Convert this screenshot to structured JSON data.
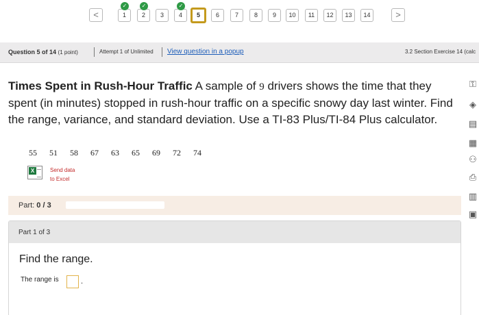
{
  "nav": {
    "prev_label": "<",
    "next_label": ">",
    "questions": [
      {
        "label": "1",
        "completed": true
      },
      {
        "label": "2",
        "completed": true
      },
      {
        "label": "3",
        "completed": false
      },
      {
        "label": "4",
        "completed": true
      },
      {
        "label": "5",
        "completed": false,
        "current": true
      },
      {
        "label": "6",
        "completed": false
      },
      {
        "label": "7",
        "completed": false
      },
      {
        "label": "8",
        "completed": false
      },
      {
        "label": "9",
        "completed": false
      },
      {
        "label": "10",
        "completed": false
      },
      {
        "label": "11",
        "completed": false
      },
      {
        "label": "12",
        "completed": false
      },
      {
        "label": "13",
        "completed": false
      },
      {
        "label": "14",
        "completed": false
      }
    ],
    "check_glyph": "✓"
  },
  "header": {
    "question_label": "Question 5 of 14",
    "points": "(1 point)",
    "attempt": "Attempt 1 of Unlimited",
    "popup_link": "View question in a popup",
    "section": "3.2 Section Exercise 14 (calc"
  },
  "question": {
    "title": "Times Spent in Rush-Hour Traffic",
    "text_before_count": " A sample of ",
    "count": "9",
    "text_after_count": " drivers shows the time that they spent (in minutes) stopped in rush-hour traffic on a specific snowy day last winter. Find the range, variance, and standard deviation. Use a TI-83 Plus/TI-84 Plus calculator.",
    "data": [
      "55",
      "51",
      "58",
      "67",
      "63",
      "65",
      "69",
      "72",
      "74"
    ],
    "excel_line1": "Send data",
    "excel_line2": "to Excel"
  },
  "part": {
    "label": "Part:",
    "progress_text": "0 / 3",
    "progress_fraction": 0.0,
    "panel_title": "Part 1 of 3",
    "prompt": "Find the range.",
    "answer_label": "The range is",
    "answer_value": "",
    "answer_suffix": "."
  },
  "toolbar": {
    "tools": [
      {
        "name": "key-icon",
        "glyph": "⚿"
      },
      {
        "name": "diamond-icon",
        "glyph": "◈"
      },
      {
        "name": "notes-icon",
        "glyph": "▤"
      },
      {
        "name": "calculator-icon",
        "glyph": "▦"
      },
      {
        "name": "people-icon",
        "glyph": "⚇"
      },
      {
        "name": "printer-icon",
        "glyph": "⎙"
      },
      {
        "name": "bar-chart-icon",
        "glyph": "▥"
      },
      {
        "name": "document-icon",
        "glyph": "▣"
      }
    ]
  },
  "colors": {
    "accent_link": "#1a5bb8",
    "current_question_border": "#c49a1d",
    "completed_check": "#2f9a46",
    "excel_text": "#c32a2a",
    "answer_box_border": "#e2b34a"
  }
}
